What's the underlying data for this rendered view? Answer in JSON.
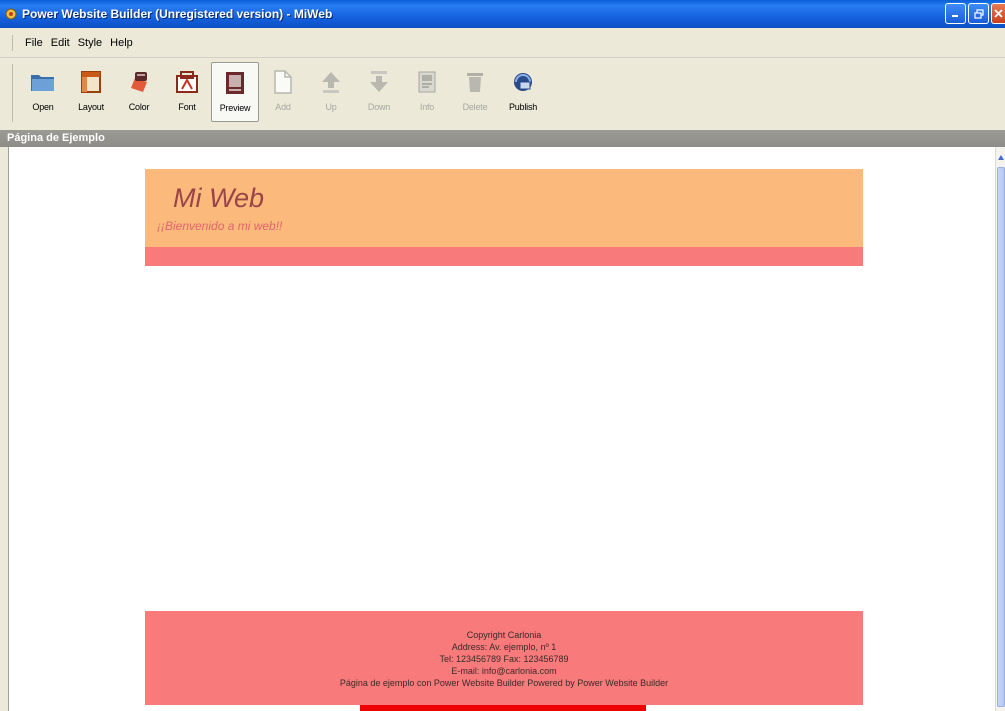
{
  "window": {
    "title": "Power Website Builder (Unregistered version) - MiWeb"
  },
  "menu": {
    "items": [
      "File",
      "Edit",
      "Style",
      "Help"
    ]
  },
  "toolbar": {
    "buttons": [
      {
        "label": "Open",
        "icon": "folder-icon",
        "enabled": true
      },
      {
        "label": "Layout",
        "icon": "layout-icon",
        "enabled": true
      },
      {
        "label": "Color",
        "icon": "color-icon",
        "enabled": true
      },
      {
        "label": "Font",
        "icon": "font-icon",
        "enabled": true
      },
      {
        "label": "Preview",
        "icon": "preview-icon",
        "enabled": true,
        "pressed": true
      },
      {
        "label": "Add",
        "icon": "add-page-icon",
        "enabled": false
      },
      {
        "label": "Up",
        "icon": "arrow-up-icon",
        "enabled": false
      },
      {
        "label": "Down",
        "icon": "arrow-down-icon",
        "enabled": false
      },
      {
        "label": "Info",
        "icon": "info-icon",
        "enabled": false
      },
      {
        "label": "Delete",
        "icon": "delete-icon",
        "enabled": false
      },
      {
        "label": "Publish",
        "icon": "publish-icon",
        "enabled": true
      }
    ]
  },
  "section": {
    "title": "Página de Ejemplo"
  },
  "preview": {
    "site_title": "Mi Web",
    "welcome": "¡¡Bienvenido a mi web!!",
    "footer": [
      "Copyright Carlonia",
      "Address: Av. ejemplo, nº 1",
      "Tel: 123456789 Fax: 123456789",
      "E-mail: info@carlonia.com",
      "Página de ejemplo con Power Website Builder Powered by Power Website Builder"
    ],
    "colors": {
      "header_bg": "#fbb97c",
      "band_bg": "#f97a7a",
      "footer_bg": "#f97a7a",
      "title_color": "#9a4448",
      "subtitle_color": "#e0666c"
    }
  }
}
